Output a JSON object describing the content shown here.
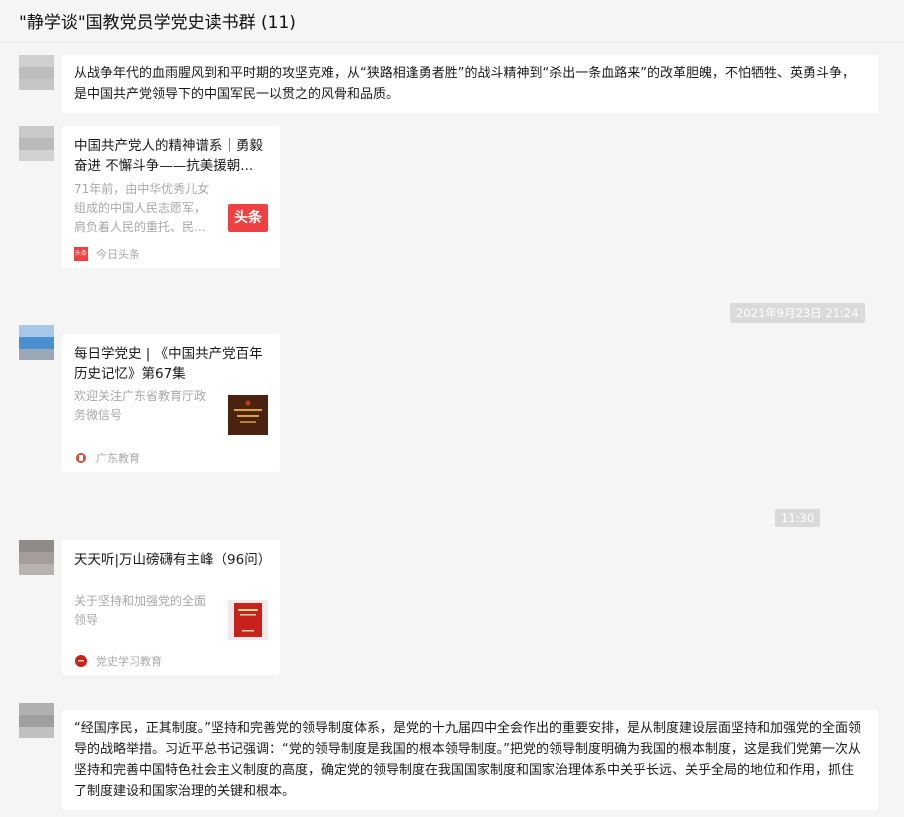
{
  "header": {
    "title": "\"静学谈\"国教党员学党史读书群 (11)"
  },
  "messages": {
    "m1": {
      "text": "从战争年代的血雨腥风到和平时期的攻坚克难，从“狭路相逢勇者胜”的战斗精神到“杀出一条血路来”的改革胆魄，不怕牺牲、英勇斗争，是中国共产党领导下的中国军民一以贯之的风骨和品质。"
    },
    "m2": {
      "title": "中国共产党人的精神谱系｜勇毅奋进 不懈斗争——抗美援朝...",
      "desc": "71年前，由中华优秀儿女组成的中国人民志愿军，肩负着人民的重托、民...",
      "thumb_text": "头条",
      "source_icon_text": "头条",
      "source": "今日头条"
    },
    "time1": "2021年9月23日 21:24",
    "m3": {
      "title": "每日学党史 | 《中国共产党百年历史记忆》第67集",
      "desc": "欢迎关注广东省教育厅政务微信号",
      "source": "广东教育"
    },
    "time2": "11:30",
    "m4": {
      "title": "天天听|万山磅礴有主峰（96问）",
      "desc": "关于坚持和加强党的全面领导",
      "source": "党史学习教育"
    },
    "m5": {
      "text": "“经国序民，正其制度。”坚持和完善党的领导制度体系，是党的十九届四中全会作出的重要安排，是从制度建设层面坚持和加强党的全面领导的战略举措。习近平总书记强调：“党的领导制度是我国的根本领导制度。”把党的领导制度明确为我国的根本制度，这是我们党第一次从坚持和完善中国特色社会主义制度的高度，确定党的领导制度在我国国家制度和国家治理体系中关乎长远、关乎全局的地位和作用，抓住了制度建设和国家治理的关键和根本。"
    }
  }
}
